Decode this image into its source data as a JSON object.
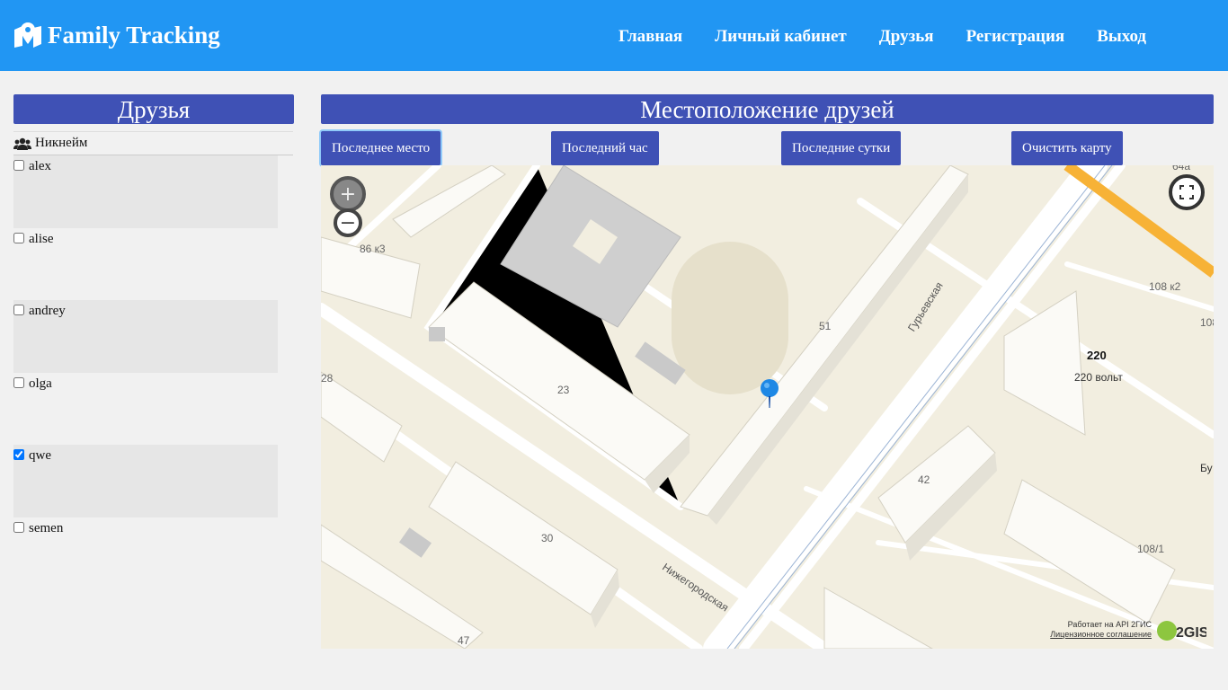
{
  "brand": {
    "title": "Family Tracking"
  },
  "nav": {
    "home": "Главная",
    "cabinet": "Личный кабинет",
    "friends": "Друзья",
    "register": "Регистрация",
    "logout": "Выход"
  },
  "friends_panel": {
    "title": "Друзья",
    "column_header": "Никнейм",
    "friends": [
      {
        "name": "alex",
        "checked": false
      },
      {
        "name": "alise",
        "checked": false
      },
      {
        "name": "andrey",
        "checked": false
      },
      {
        "name": "olga",
        "checked": false
      },
      {
        "name": "qwe",
        "checked": true
      },
      {
        "name": "semen",
        "checked": false
      }
    ]
  },
  "map_panel": {
    "title": "Местоположение друзей",
    "buttons": {
      "last_place": "Последнее место",
      "last_hour": "Последний час",
      "last_day": "Последние сутки",
      "clear": "Очистить карту"
    },
    "labels": {
      "b86": "86 к3",
      "b51": "51",
      "b23": "23",
      "b28": "28",
      "b30": "30",
      "b42": "42",
      "b47": "47",
      "b108k2": "108 к2",
      "b108": "108",
      "b108_1": "108/1",
      "b64a": "64а",
      "shop": "220 вольт",
      "shop_logo": "220",
      "partial": "Бу"
    },
    "streets": {
      "guryevskaya": "Гурьевская",
      "nizhegorodskaya": "Нижегородская"
    },
    "attribution": {
      "line1": "Работает на API 2ГИС",
      "line2": "Лицензионное соглашение",
      "logo": "2GIS"
    },
    "zoom_in": "+",
    "zoom_out": "−"
  },
  "colors": {
    "navbar": "#2196f3",
    "panel_header": "#3f51b5",
    "map_bg": "#f2eee0",
    "marker": "#1e88e5"
  }
}
